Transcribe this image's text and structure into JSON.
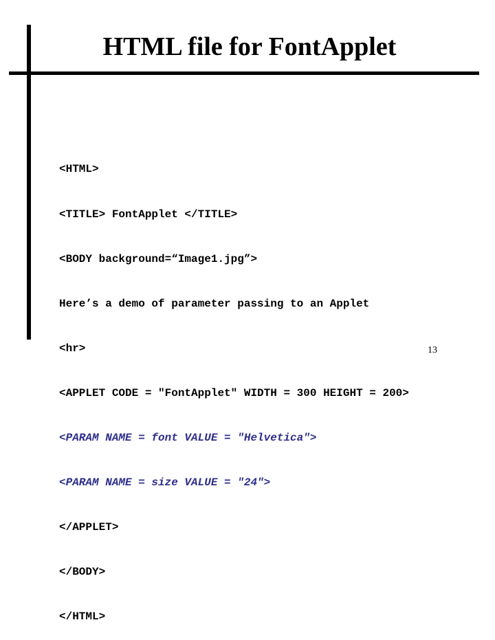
{
  "slide": {
    "title": "HTML file for FontApplet",
    "page_number": "13",
    "code_lines": [
      {
        "text": "<HTML>",
        "style": "normal"
      },
      {
        "text": "<TITLE> FontApplet </TITLE>",
        "style": "normal"
      },
      {
        "text": "<BODY background=“Image1.jpg”>",
        "style": "normal"
      },
      {
        "text": "Here’s a demo of parameter passing to an Applet",
        "style": "normal"
      },
      {
        "text": "<hr>",
        "style": "normal"
      },
      {
        "text": "<APPLET CODE = \"FontApplet\" WIDTH = 300 HEIGHT = 200>",
        "style": "normal"
      },
      {
        "text": "<PARAM NAME = font VALUE = \"Helvetica\">",
        "style": "param"
      },
      {
        "text": "<PARAM NAME = size VALUE = \"24\">",
        "style": "param"
      },
      {
        "text": "</APPLET>",
        "style": "normal"
      },
      {
        "text": "</BODY>",
        "style": "normal"
      },
      {
        "text": "</HTML>",
        "style": "normal"
      }
    ],
    "colors": {
      "text": "#000000",
      "param_highlight": "#2e2e8c",
      "background": "#ffffff"
    }
  }
}
